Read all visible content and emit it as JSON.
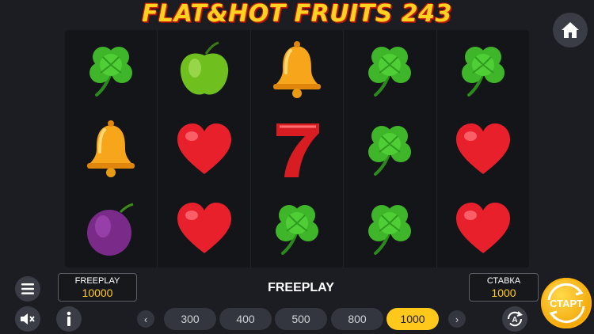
{
  "game": {
    "title": "FLAT&HOT FRUITS 243"
  },
  "reels": [
    [
      "clover-icon",
      "bell-icon",
      "plum-icon"
    ],
    [
      "apple-icon",
      "heart-icon",
      "heart-icon"
    ],
    [
      "bell-icon",
      "seven-icon",
      "clover-icon"
    ],
    [
      "clover-icon",
      "clover-icon",
      "clover-icon"
    ],
    [
      "clover-icon",
      "heart-icon",
      "heart-icon"
    ]
  ],
  "balance": {
    "label": "FREEPLAY",
    "value": "10000"
  },
  "stake": {
    "label": "СТАВКА",
    "value": "1000"
  },
  "status": {
    "text": "FREEPLAY"
  },
  "bets": {
    "options": [
      "300",
      "400",
      "500",
      "800",
      "1000"
    ],
    "selected": "1000"
  },
  "buttons": {
    "start_label": "СТАРТ"
  },
  "colors": {
    "accent": "#ffc81a",
    "background": "#1b1d23",
    "title": "#ffd21f"
  }
}
